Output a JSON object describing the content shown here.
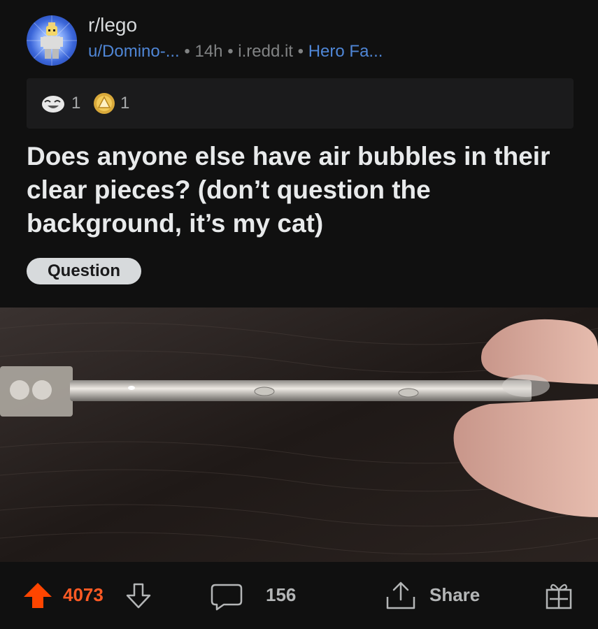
{
  "post": {
    "subreddit": "r/lego",
    "author": "u/Domino-...",
    "age": "14h",
    "domain": "i.redd.it",
    "flair": "Hero Fa...",
    "awards": [
      {
        "icon": "laughing-award-icon",
        "count": "1"
      },
      {
        "icon": "gold-award-icon",
        "count": "1"
      }
    ],
    "title": "Does anyone else have air bubbles in their clear pieces? (don’t question the background, it’s my cat)",
    "tag": "Question",
    "image_alt": "clear-lego-bar-on-cat-fur-photo"
  },
  "actions": {
    "votes": "4073",
    "comments": "156",
    "share_label": "Share"
  },
  "colors": {
    "upvote": "#ff4500",
    "link": "#4f86d6",
    "background": "#101010"
  }
}
